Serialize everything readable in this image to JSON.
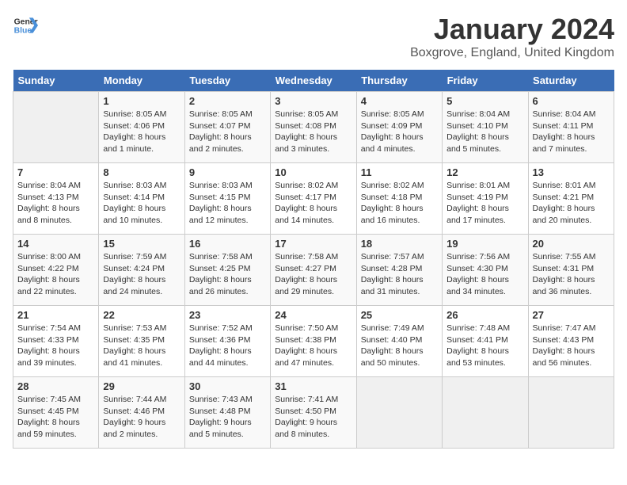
{
  "header": {
    "logo_line1": "General",
    "logo_line2": "Blue",
    "title": "January 2024",
    "subtitle": "Boxgrove, England, United Kingdom"
  },
  "weekdays": [
    "Sunday",
    "Monday",
    "Tuesday",
    "Wednesday",
    "Thursday",
    "Friday",
    "Saturday"
  ],
  "weeks": [
    [
      {
        "day": "",
        "info": ""
      },
      {
        "day": "1",
        "info": "Sunrise: 8:05 AM\nSunset: 4:06 PM\nDaylight: 8 hours\nand 1 minute."
      },
      {
        "day": "2",
        "info": "Sunrise: 8:05 AM\nSunset: 4:07 PM\nDaylight: 8 hours\nand 2 minutes."
      },
      {
        "day": "3",
        "info": "Sunrise: 8:05 AM\nSunset: 4:08 PM\nDaylight: 8 hours\nand 3 minutes."
      },
      {
        "day": "4",
        "info": "Sunrise: 8:05 AM\nSunset: 4:09 PM\nDaylight: 8 hours\nand 4 minutes."
      },
      {
        "day": "5",
        "info": "Sunrise: 8:04 AM\nSunset: 4:10 PM\nDaylight: 8 hours\nand 5 minutes."
      },
      {
        "day": "6",
        "info": "Sunrise: 8:04 AM\nSunset: 4:11 PM\nDaylight: 8 hours\nand 7 minutes."
      }
    ],
    [
      {
        "day": "7",
        "info": "Sunrise: 8:04 AM\nSunset: 4:13 PM\nDaylight: 8 hours\nand 8 minutes."
      },
      {
        "day": "8",
        "info": "Sunrise: 8:03 AM\nSunset: 4:14 PM\nDaylight: 8 hours\nand 10 minutes."
      },
      {
        "day": "9",
        "info": "Sunrise: 8:03 AM\nSunset: 4:15 PM\nDaylight: 8 hours\nand 12 minutes."
      },
      {
        "day": "10",
        "info": "Sunrise: 8:02 AM\nSunset: 4:17 PM\nDaylight: 8 hours\nand 14 minutes."
      },
      {
        "day": "11",
        "info": "Sunrise: 8:02 AM\nSunset: 4:18 PM\nDaylight: 8 hours\nand 16 minutes."
      },
      {
        "day": "12",
        "info": "Sunrise: 8:01 AM\nSunset: 4:19 PM\nDaylight: 8 hours\nand 17 minutes."
      },
      {
        "day": "13",
        "info": "Sunrise: 8:01 AM\nSunset: 4:21 PM\nDaylight: 8 hours\nand 20 minutes."
      }
    ],
    [
      {
        "day": "14",
        "info": "Sunrise: 8:00 AM\nSunset: 4:22 PM\nDaylight: 8 hours\nand 22 minutes."
      },
      {
        "day": "15",
        "info": "Sunrise: 7:59 AM\nSunset: 4:24 PM\nDaylight: 8 hours\nand 24 minutes."
      },
      {
        "day": "16",
        "info": "Sunrise: 7:58 AM\nSunset: 4:25 PM\nDaylight: 8 hours\nand 26 minutes."
      },
      {
        "day": "17",
        "info": "Sunrise: 7:58 AM\nSunset: 4:27 PM\nDaylight: 8 hours\nand 29 minutes."
      },
      {
        "day": "18",
        "info": "Sunrise: 7:57 AM\nSunset: 4:28 PM\nDaylight: 8 hours\nand 31 minutes."
      },
      {
        "day": "19",
        "info": "Sunrise: 7:56 AM\nSunset: 4:30 PM\nDaylight: 8 hours\nand 34 minutes."
      },
      {
        "day": "20",
        "info": "Sunrise: 7:55 AM\nSunset: 4:31 PM\nDaylight: 8 hours\nand 36 minutes."
      }
    ],
    [
      {
        "day": "21",
        "info": "Sunrise: 7:54 AM\nSunset: 4:33 PM\nDaylight: 8 hours\nand 39 minutes."
      },
      {
        "day": "22",
        "info": "Sunrise: 7:53 AM\nSunset: 4:35 PM\nDaylight: 8 hours\nand 41 minutes."
      },
      {
        "day": "23",
        "info": "Sunrise: 7:52 AM\nSunset: 4:36 PM\nDaylight: 8 hours\nand 44 minutes."
      },
      {
        "day": "24",
        "info": "Sunrise: 7:50 AM\nSunset: 4:38 PM\nDaylight: 8 hours\nand 47 minutes."
      },
      {
        "day": "25",
        "info": "Sunrise: 7:49 AM\nSunset: 4:40 PM\nDaylight: 8 hours\nand 50 minutes."
      },
      {
        "day": "26",
        "info": "Sunrise: 7:48 AM\nSunset: 4:41 PM\nDaylight: 8 hours\nand 53 minutes."
      },
      {
        "day": "27",
        "info": "Sunrise: 7:47 AM\nSunset: 4:43 PM\nDaylight: 8 hours\nand 56 minutes."
      }
    ],
    [
      {
        "day": "28",
        "info": "Sunrise: 7:45 AM\nSunset: 4:45 PM\nDaylight: 8 hours\nand 59 minutes."
      },
      {
        "day": "29",
        "info": "Sunrise: 7:44 AM\nSunset: 4:46 PM\nDaylight: 9 hours\nand 2 minutes."
      },
      {
        "day": "30",
        "info": "Sunrise: 7:43 AM\nSunset: 4:48 PM\nDaylight: 9 hours\nand 5 minutes."
      },
      {
        "day": "31",
        "info": "Sunrise: 7:41 AM\nSunset: 4:50 PM\nDaylight: 9 hours\nand 8 minutes."
      },
      {
        "day": "",
        "info": ""
      },
      {
        "day": "",
        "info": ""
      },
      {
        "day": "",
        "info": ""
      }
    ]
  ]
}
